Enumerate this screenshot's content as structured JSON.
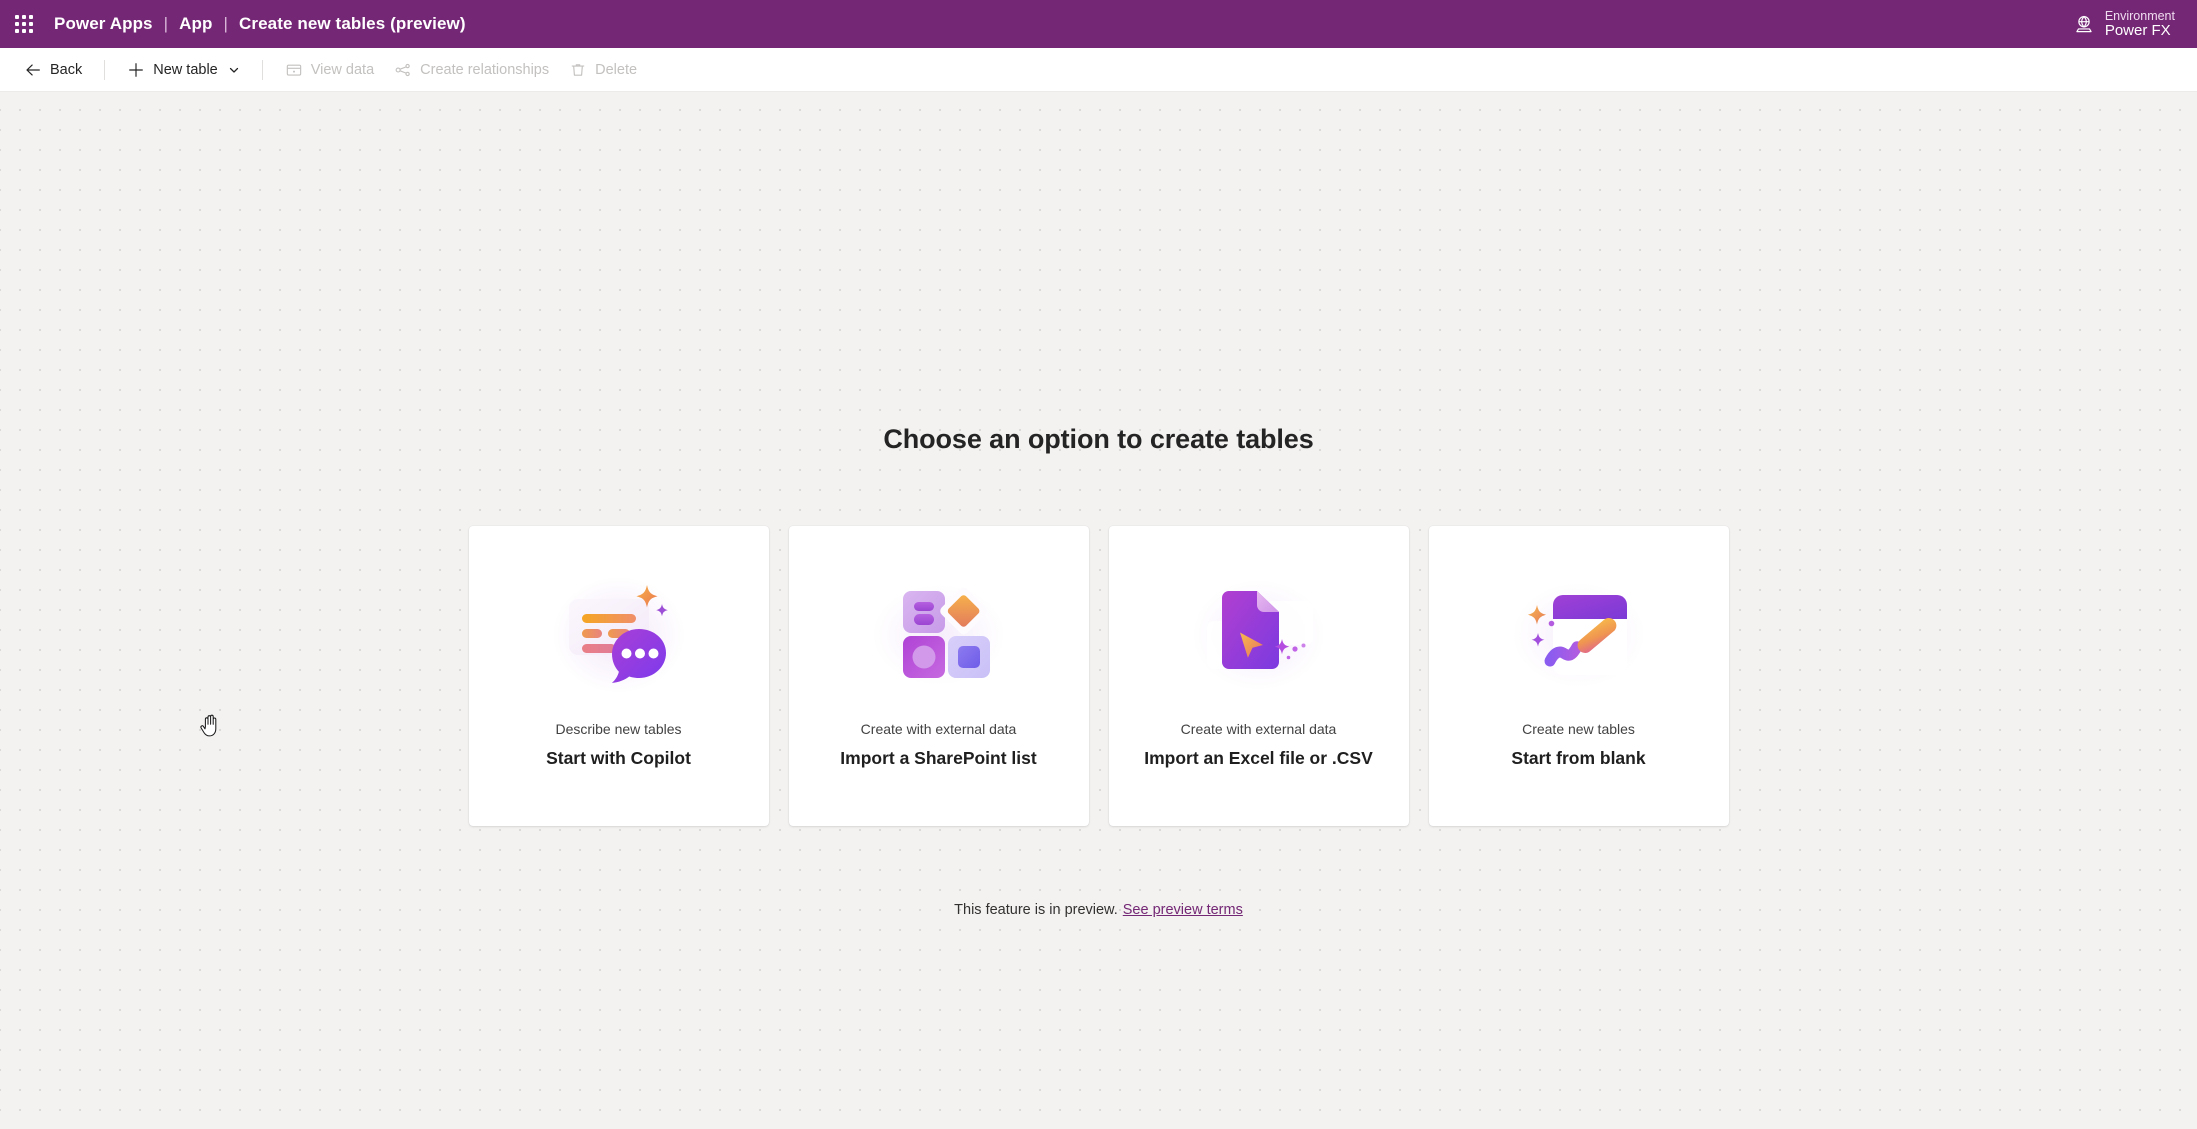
{
  "brandbar": {
    "waffle_icon": "app-launcher-grid-icon",
    "product": "Power Apps",
    "section": "App",
    "page": "Create new tables (preview)",
    "separator": "|",
    "environment": {
      "icon": "environment-globe-icon",
      "label": "Environment",
      "value": "Power FX"
    },
    "background_color": "#742774"
  },
  "commandbar": {
    "items": [
      {
        "label": "Back",
        "icon": "arrow-left-icon",
        "disabled": false,
        "chevron": false
      },
      {
        "label": "New table",
        "icon": "plus-icon",
        "disabled": false,
        "chevron": true
      },
      {
        "label": "View data",
        "icon": "table-view-icon",
        "disabled": true,
        "chevron": false
      },
      {
        "label": "Create relationships",
        "icon": "relationship-nodes-icon",
        "disabled": true,
        "chevron": false
      },
      {
        "label": "Delete",
        "icon": "trash-icon",
        "disabled": true,
        "chevron": false
      }
    ]
  },
  "main": {
    "heading": "Choose an option to create tables",
    "cursor_icon": "open-hand-cursor",
    "cards": [
      {
        "subtitle": "Describe new tables",
        "title": "Start with Copilot",
        "art": "copilot-chat-illustration"
      },
      {
        "subtitle": "Create with external data",
        "title": "Import a SharePoint list",
        "art": "sharepoint-blocks-illustration"
      },
      {
        "subtitle": "Create with external data",
        "title": "Import an Excel file or .CSV",
        "art": "excel-file-cursor-illustration"
      },
      {
        "subtitle": "Create new tables",
        "title": "Start from blank",
        "art": "blank-table-pen-illustration"
      }
    ],
    "footnote": {
      "text": "This feature is in preview.",
      "link": "See preview terms"
    }
  },
  "colors": {
    "brand_purple": "#742774",
    "canvas": "#f3f2f1",
    "card": "#ffffff",
    "link": "#742774",
    "disabled_text": "#c3c1bf"
  }
}
